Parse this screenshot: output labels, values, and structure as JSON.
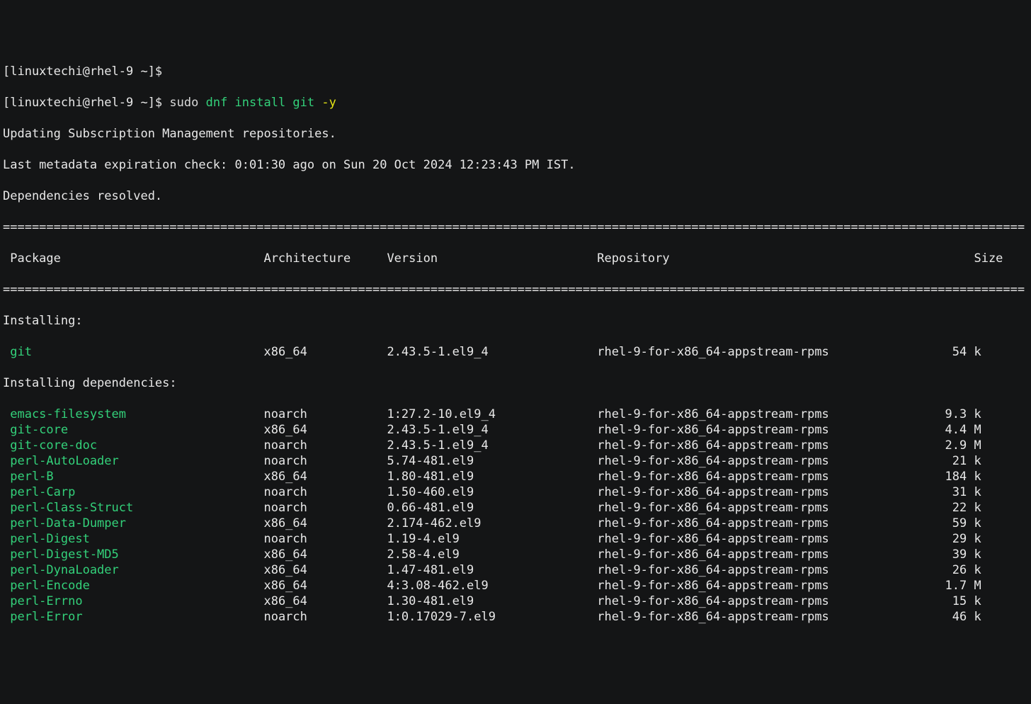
{
  "prompt1": "[linuxtechi@rhel-9 ~]$",
  "prompt2": "[linuxtechi@rhel-9 ~]$ ",
  "cmd_sudo": "sudo ",
  "cmd_main": "dnf install git ",
  "cmd_flag": "-y",
  "line_repo": "Updating Subscription Management repositories.",
  "line_meta": "Last metadata expiration check: 0:01:30 ago on Sun 20 Oct 2024 12:23:43 PM IST.",
  "line_deps": "Dependencies resolved.",
  "sep_line": "=============================================================================================================================================",
  "hdr_pkg": " Package                            Architecture     Version                      Repository                                          Size",
  "label_installing": "Installing:",
  "label_installing_deps": "Installing dependencies:",
  "rows": [
    {
      "name": "git",
      "arch": "x86_64",
      "ver": "2.43.5-1.el9_4",
      "repo": "rhel-9-for-x86_64-appstream-rpms",
      "size": "54 k"
    },
    {
      "name": "emacs-filesystem",
      "arch": "noarch",
      "ver": "1:27.2-10.el9_4",
      "repo": "rhel-9-for-x86_64-appstream-rpms",
      "size": "9.3 k"
    },
    {
      "name": "git-core",
      "arch": "x86_64",
      "ver": "2.43.5-1.el9_4",
      "repo": "rhel-9-for-x86_64-appstream-rpms",
      "size": "4.4 M"
    },
    {
      "name": "git-core-doc",
      "arch": "noarch",
      "ver": "2.43.5-1.el9_4",
      "repo": "rhel-9-for-x86_64-appstream-rpms",
      "size": "2.9 M"
    },
    {
      "name": "perl-AutoLoader",
      "arch": "noarch",
      "ver": "5.74-481.el9",
      "repo": "rhel-9-for-x86_64-appstream-rpms",
      "size": "21 k"
    },
    {
      "name": "perl-B",
      "arch": "x86_64",
      "ver": "1.80-481.el9",
      "repo": "rhel-9-for-x86_64-appstream-rpms",
      "size": "184 k"
    },
    {
      "name": "perl-Carp",
      "arch": "noarch",
      "ver": "1.50-460.el9",
      "repo": "rhel-9-for-x86_64-appstream-rpms",
      "size": "31 k"
    },
    {
      "name": "perl-Class-Struct",
      "arch": "noarch",
      "ver": "0.66-481.el9",
      "repo": "rhel-9-for-x86_64-appstream-rpms",
      "size": "22 k"
    },
    {
      "name": "perl-Data-Dumper",
      "arch": "x86_64",
      "ver": "2.174-462.el9",
      "repo": "rhel-9-for-x86_64-appstream-rpms",
      "size": "59 k"
    },
    {
      "name": "perl-Digest",
      "arch": "noarch",
      "ver": "1.19-4.el9",
      "repo": "rhel-9-for-x86_64-appstream-rpms",
      "size": "29 k"
    },
    {
      "name": "perl-Digest-MD5",
      "arch": "x86_64",
      "ver": "2.58-4.el9",
      "repo": "rhel-9-for-x86_64-appstream-rpms",
      "size": "39 k"
    },
    {
      "name": "perl-DynaLoader",
      "arch": "x86_64",
      "ver": "1.47-481.el9",
      "repo": "rhel-9-for-x86_64-appstream-rpms",
      "size": "26 k"
    },
    {
      "name": "perl-Encode",
      "arch": "x86_64",
      "ver": "4:3.08-462.el9",
      "repo": "rhel-9-for-x86_64-appstream-rpms",
      "size": "1.7 M"
    },
    {
      "name": "perl-Errno",
      "arch": "x86_64",
      "ver": "1.30-481.el9",
      "repo": "rhel-9-for-x86_64-appstream-rpms",
      "size": "15 k"
    },
    {
      "name": "perl-Error",
      "arch": "noarch",
      "ver": "1:0.17029-7.el9",
      "repo": "rhel-9-for-x86_64-appstream-rpms",
      "size": "46 k"
    }
  ]
}
